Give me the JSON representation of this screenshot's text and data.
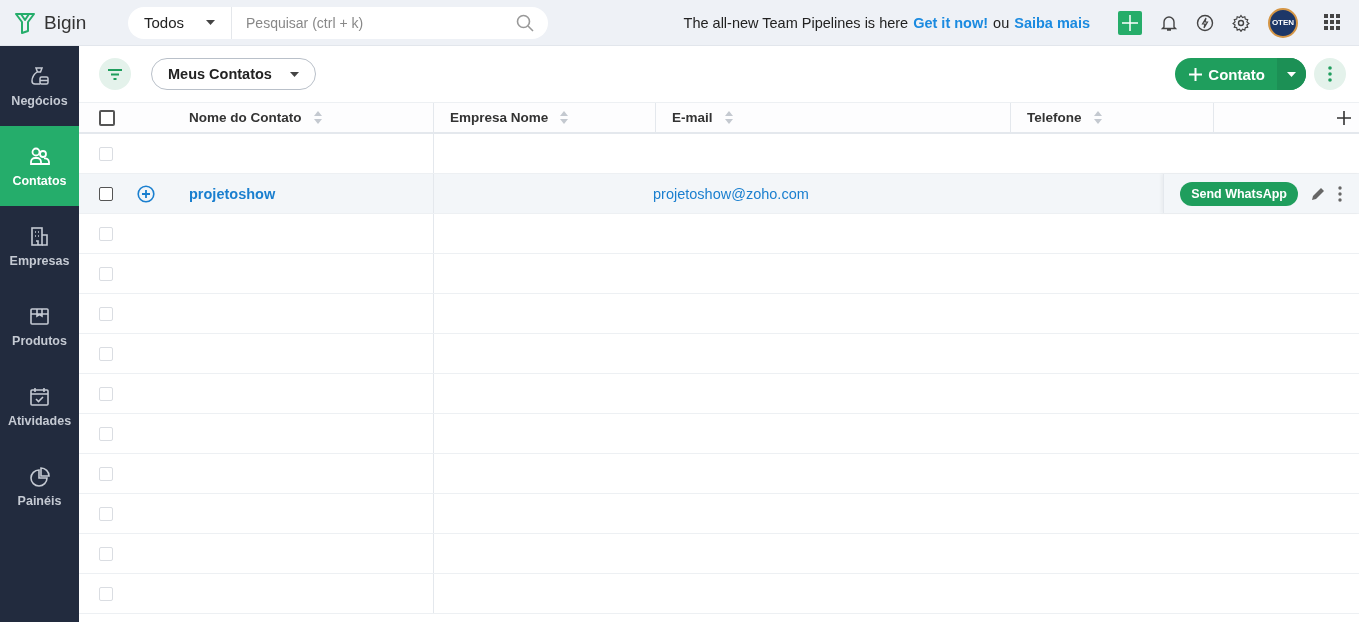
{
  "app": {
    "name": "Bigin"
  },
  "search": {
    "scope": "Todos",
    "placeholder": "Pesquisar (ctrl + k)"
  },
  "banner": {
    "text": "The all-new Team Pipelines is here",
    "link": "Get it now!",
    "separator": "ou",
    "link2": "Saiba mais"
  },
  "avatar": {
    "label": "OTEN"
  },
  "sidebar": {
    "items": [
      {
        "label": "Negócios",
        "selected": false
      },
      {
        "label": "Contatos",
        "selected": true
      },
      {
        "label": "Empresas",
        "selected": false
      },
      {
        "label": "Produtos",
        "selected": false
      },
      {
        "label": "Atividades",
        "selected": false
      },
      {
        "label": "Painéis",
        "selected": false
      }
    ]
  },
  "toolbar": {
    "view": "Meus Contatos",
    "new_button": "Contato"
  },
  "table": {
    "select_all": {
      "checked": false
    },
    "columns": [
      "Nome do Contato",
      "Empresa Nome",
      "E-mail",
      "Telefone"
    ],
    "rows": [
      {
        "checked": false,
        "hovered": false
      },
      {
        "checked": false,
        "hovered": true,
        "name": "projetoshow",
        "email": "projetoshow@zoho.com",
        "action": "Send WhatsApp"
      },
      {
        "checked": false,
        "hovered": false
      },
      {
        "checked": false,
        "hovered": false
      },
      {
        "checked": false,
        "hovered": false
      },
      {
        "checked": false,
        "hovered": false
      },
      {
        "checked": false,
        "hovered": false
      },
      {
        "checked": false,
        "hovered": false
      },
      {
        "checked": false,
        "hovered": false
      },
      {
        "checked": false,
        "hovered": false
      },
      {
        "checked": false,
        "hovered": false
      },
      {
        "checked": false,
        "hovered": false
      }
    ]
  }
}
